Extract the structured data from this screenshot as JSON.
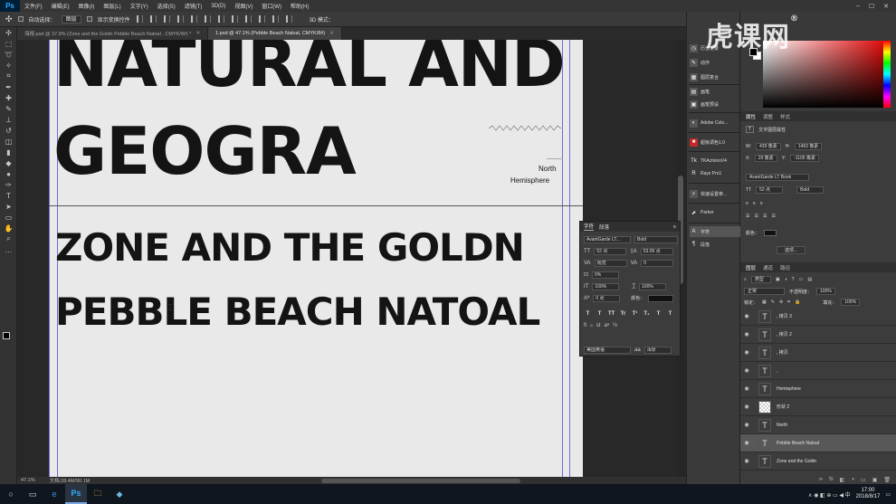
{
  "app": {
    "logo": "Ps",
    "menu": [
      "文件(F)",
      "编辑(E)",
      "图像(I)",
      "图层(L)",
      "文字(Y)",
      "选择(S)",
      "滤镜(T)",
      "3D(D)",
      "视图(V)",
      "窗口(W)",
      "帮助(H)"
    ],
    "window_controls": [
      "–",
      "☐",
      "✕"
    ]
  },
  "options_bar": {
    "auto_select_label": "自动选择：",
    "auto_select_value": "图层",
    "show_transform_label": "显示变换控件",
    "mode_3d_label": "3D 模式："
  },
  "tabs": [
    {
      "label": "海报.psd @ 37.9% (Zone and the Goldn Pebble Beach Natoal , CMYK/8#) *",
      "active": false
    },
    {
      "label": "1.psd @ 47.1% (Pebble Beach Natoal, CMYK/8#)",
      "active": true
    }
  ],
  "canvas": {
    "line1": "NATURAL AND",
    "line2": "GEOGRA",
    "line3": "ZONE AND THE GOLDN",
    "line4": "PEBBLE BEACH NATOAL",
    "small1": "North",
    "small2": "Hemisphere"
  },
  "status": {
    "zoom": "47.1%",
    "doc": "文档:28.4M/90.1M"
  },
  "character_panel": {
    "tabs": [
      "字符",
      "段落"
    ],
    "font_family": "AvantGarde LT...",
    "font_style": "Bold",
    "size": "52 点",
    "leading": "53.09 点",
    "kerning": "视觉",
    "tracking": "0",
    "scale_pct": "0%",
    "v_scale": "100%",
    "h_scale": "100%",
    "baseline": "0 点",
    "color_label": "颜色：",
    "language": "美国英语",
    "aa_label": "aa",
    "aa_value": "浑厚",
    "style_buttons": [
      "T",
      "T",
      "TT",
      "Tr",
      "T¹",
      "T₁",
      "T",
      "T"
    ]
  },
  "dock": [
    {
      "icon": "◷",
      "label": "历史记录"
    },
    {
      "icon": "✎",
      "label": "动作"
    },
    {
      "icon": "▦",
      "label": "图层复合"
    },
    {
      "icon": "▤",
      "label": "画笔"
    },
    {
      "icon": "▣",
      "label": "画笔预设"
    },
    {
      "icon": "◐",
      "label": "Adobe Colo..."
    },
    {
      "icon": "■",
      "label": "超级调色1.0"
    },
    {
      "icon": "Tk",
      "label": "TKActionsV4"
    },
    {
      "icon": "R",
      "label": "Rays Pro1"
    },
    {
      "icon": "⚡",
      "label": "快速设置参..."
    },
    {
      "icon": "⬈",
      "label": "Parker"
    },
    {
      "icon": "A",
      "label": "字符"
    },
    {
      "icon": "¶",
      "label": "段落"
    }
  ],
  "properties": {
    "tabs": [
      "属性",
      "调整",
      "样式"
    ],
    "title": "文字图层属性",
    "w_label": "W:",
    "w_value": "439 像素",
    "h_label": "H:",
    "h_value": "1463 像素",
    "x_label": "X:",
    "x_value": "29 像素",
    "y_label": "Y:",
    "y_value": "-1105 像素",
    "font": "AvantGarde LT Book",
    "size": "52 点",
    "style": "Bold",
    "color_label": "颜色：",
    "more_button": "选项..."
  },
  "layers": {
    "tabs": [
      "图层",
      "通道",
      "路径"
    ],
    "filter": "类型",
    "blend": "正常",
    "opacity_label": "不透明度：",
    "opacity": "100%",
    "lock_label": "锁定：",
    "fill_label": "填充：",
    "fill": "100%",
    "items": [
      {
        "icon": "T",
        "name": ", 拷贝 3",
        "kind": "text",
        "selected": false
      },
      {
        "icon": "T",
        "name": ", 拷贝 2",
        "kind": "text",
        "selected": false
      },
      {
        "icon": "T",
        "name": ", 拷贝",
        "kind": "text",
        "selected": false
      },
      {
        "icon": "T",
        "name": ",",
        "kind": "text",
        "selected": false
      },
      {
        "icon": "T",
        "name": "Hemisphere",
        "kind": "text",
        "selected": false
      },
      {
        "icon": "",
        "name": "形状 2",
        "kind": "shape",
        "selected": false
      },
      {
        "icon": "T",
        "name": "North",
        "kind": "text",
        "selected": false
      },
      {
        "icon": "T",
        "name": "Pebble Beach Natoal",
        "kind": "text",
        "selected": true
      },
      {
        "icon": "T",
        "name": "Zone and the Goldn",
        "kind": "text",
        "selected": false
      }
    ],
    "footer_icons": [
      "∞",
      "fx",
      "◧",
      "◑",
      "▭",
      "▣",
      "🗑"
    ]
  },
  "watermark": "虎课网",
  "taskbar": {
    "apps": [
      "○",
      "▭",
      "e",
      "Ps",
      "🗀",
      "◆"
    ],
    "time": "17:00",
    "date": "2018/8/17",
    "tray": "∧ ◉ ◧ ⊕ ▭ ◀ 中"
  },
  "colors": {
    "accent": "#31a8ff",
    "guide": "#6d6bd6",
    "canvas_bg": "#e9e9e9",
    "text": "#141414"
  }
}
